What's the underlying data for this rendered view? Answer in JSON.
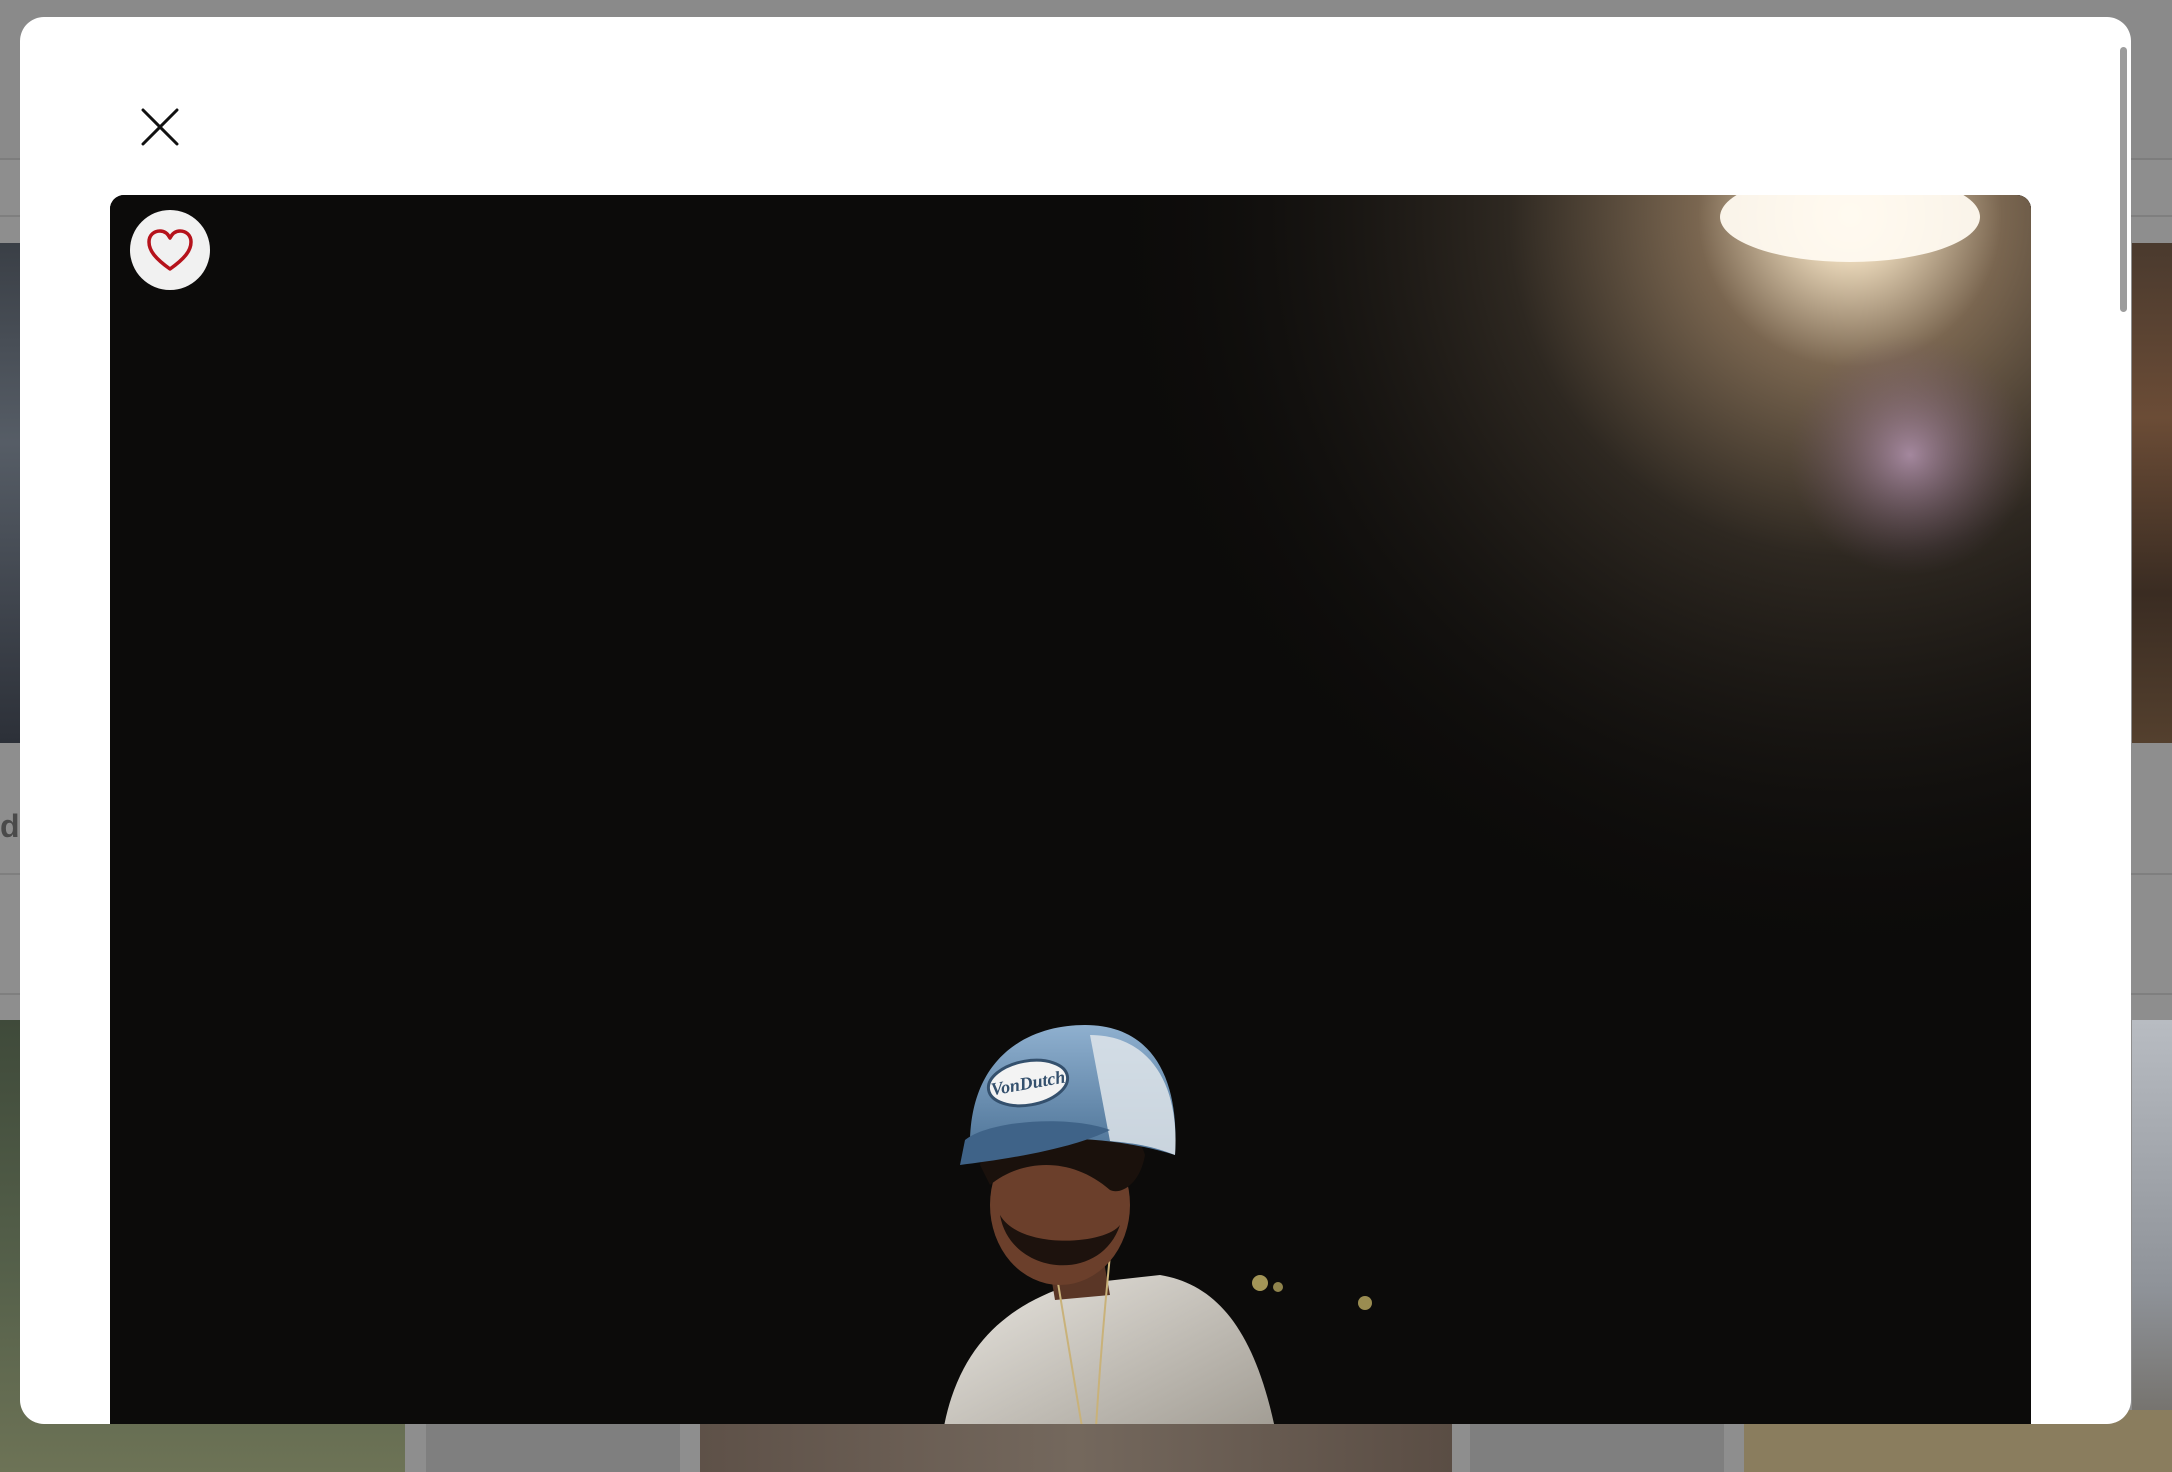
{
  "background": {
    "heading_fragment": "da"
  },
  "modal": {
    "close_icon": "close-icon",
    "photo": {
      "subject": "photo",
      "cap_text": "VonDutch"
    },
    "like_button": {
      "icon": "heart-icon",
      "color": "#b5121b"
    }
  },
  "colors": {
    "overlay": "#8e8e8e",
    "modal_bg": "#ffffff",
    "heart": "#b5121b"
  }
}
